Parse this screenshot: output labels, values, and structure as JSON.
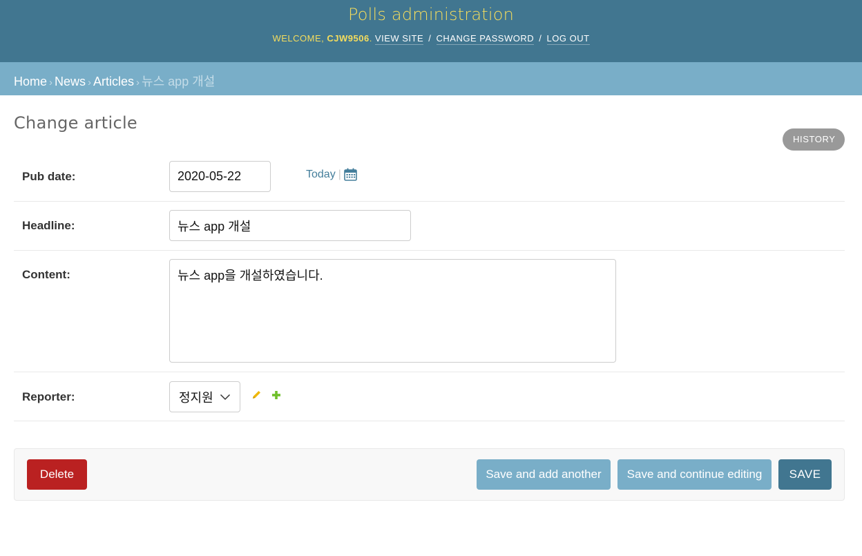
{
  "header": {
    "site_name": "Polls administration",
    "welcome_prefix": "WELCOME, ",
    "username": "CJW9506",
    "welcome_suffix": ". ",
    "view_site": "VIEW SITE",
    "change_password": "CHANGE PASSWORD",
    "log_out": "LOG OUT",
    "separator": "/"
  },
  "breadcrumbs": {
    "home": "Home",
    "app": "News",
    "model": "Articles",
    "current": "뉴스 app 개설",
    "arrow": "›"
  },
  "page": {
    "title": "Change article",
    "history": "HISTORY"
  },
  "form": {
    "pub_date": {
      "label": "Pub date:",
      "value": "2020-05-22",
      "today": "Today",
      "pipe": "|"
    },
    "headline": {
      "label": "Headline:",
      "value": "뉴스 app 개설"
    },
    "content": {
      "label": "Content:",
      "value": "뉴스 app을 개설하였습니다."
    },
    "reporter": {
      "label": "Reporter:",
      "value": "정지원"
    }
  },
  "submit_row": {
    "delete": "Delete",
    "save_add_another": "Save and add another",
    "save_continue": "Save and continue editing",
    "save": "SAVE"
  },
  "colors": {
    "header_bg": "#417690",
    "breadcrumbs_bg": "#79aec8",
    "site_name": "#f5dd5d",
    "delete": "#ba2121",
    "change_link_icon": "#efb80b",
    "add_link_icon": "#70bf2b"
  }
}
